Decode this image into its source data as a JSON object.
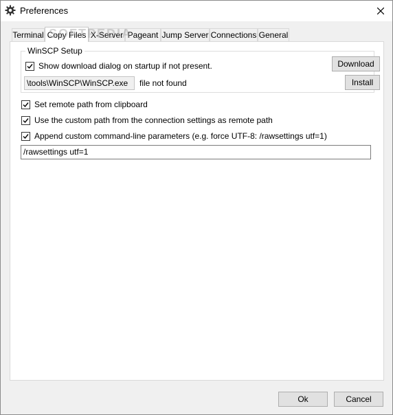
{
  "window": {
    "title": "Preferences",
    "icon": "gear-icon",
    "close_icon": "close-icon"
  },
  "tabs": [
    {
      "label": "Terminal",
      "active": false
    },
    {
      "label": "Copy Files",
      "active": true
    },
    {
      "label": "X-Server",
      "active": false
    },
    {
      "label": "Pageant",
      "active": false
    },
    {
      "label": "Jump Server",
      "active": false
    },
    {
      "label": "Connections",
      "active": false
    },
    {
      "label": "General",
      "active": false
    }
  ],
  "winscp_setup": {
    "group_title": "WinSCP Setup",
    "show_download_dialog_label": "Show download dialog on startup if not present.",
    "show_download_dialog_checked": true,
    "download_button": "Download",
    "path_value": "\\tools\\WinSCP\\WinSCP.exe",
    "path_status": "file not found",
    "install_button": "Install"
  },
  "options": [
    {
      "label": "Set remote path from clipboard",
      "checked": true
    },
    {
      "label": "Use the custom path from the connection settings as remote path",
      "checked": true
    },
    {
      "label": "Append custom command-line parameters (e.g. force UTF-8: /rawsettings utf=1)",
      "checked": true
    }
  ],
  "custom_params_value": "/rawsettings utf=1",
  "footer": {
    "ok_button": "Ok",
    "cancel_button": "Cancel"
  },
  "watermark": "SOFTPEDIA"
}
